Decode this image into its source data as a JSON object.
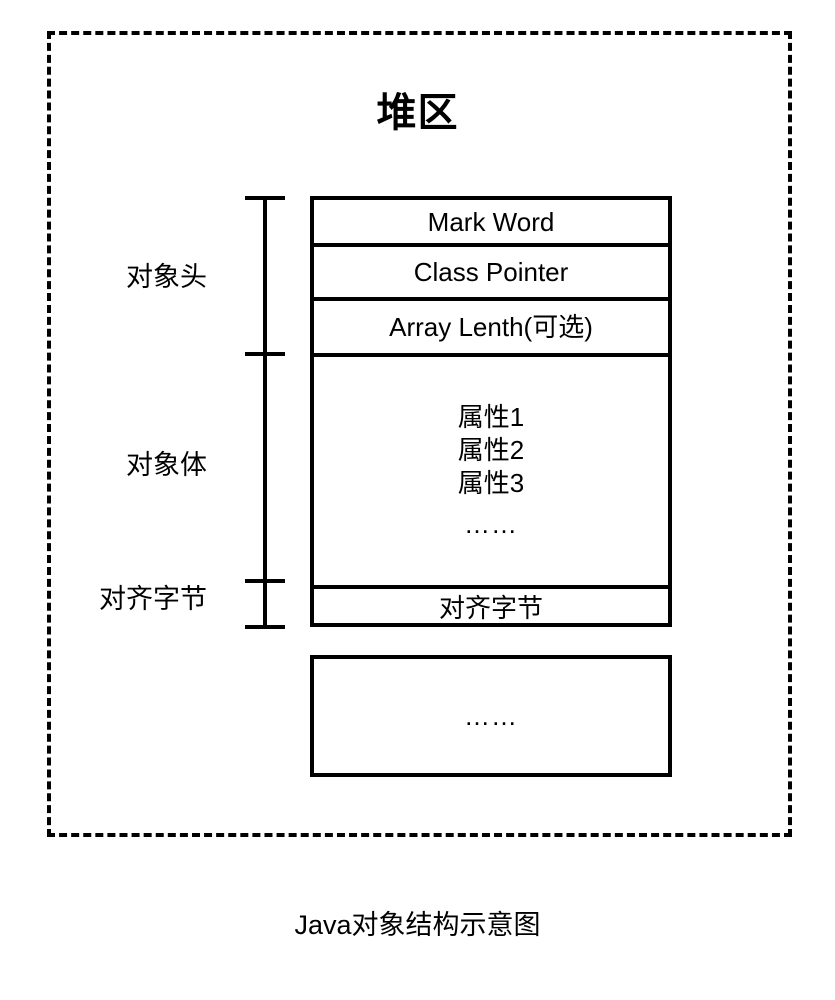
{
  "diagram": {
    "caption": "Java对象结构示意图",
    "heap": {
      "title": "堆区",
      "border_style": "dashed",
      "border_color": "#000000"
    },
    "object_box": {
      "rows": [
        {
          "id": "mark-word",
          "label": "Mark Word"
        },
        {
          "id": "class-pointer",
          "label": "Class Pointer"
        },
        {
          "id": "array-length",
          "label": "Array Lenth(可选)"
        }
      ],
      "body": {
        "fields": [
          "属性1",
          "属性2",
          "属性3"
        ],
        "ellipsis": "……"
      },
      "padding_row": {
        "label": "对齐字节"
      }
    },
    "more_objects_box": {
      "label": "……"
    },
    "side_labels": [
      {
        "id": "object-header",
        "label": "对象头"
      },
      {
        "id": "object-body",
        "label": "对象体"
      },
      {
        "id": "padding-bytes",
        "label": "对齐字节"
      }
    ]
  }
}
